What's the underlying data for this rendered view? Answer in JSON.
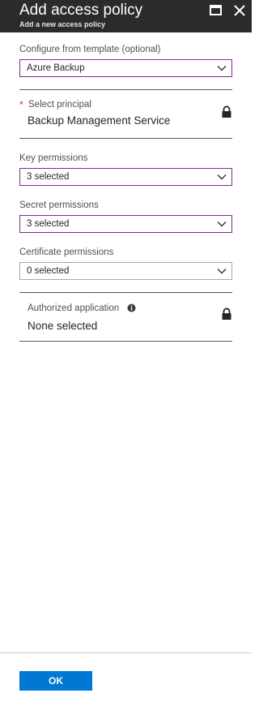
{
  "header": {
    "title": "Add access policy",
    "subtitle": "Add a new access policy"
  },
  "template": {
    "label": "Configure from template (optional)",
    "value": "Azure Backup"
  },
  "principal": {
    "required_mark": "*",
    "label": "Select principal",
    "value": "Backup Management Service"
  },
  "key_permissions": {
    "label": "Key permissions",
    "value": "3 selected"
  },
  "secret_permissions": {
    "label": "Secret permissions",
    "value": "3 selected"
  },
  "certificate_permissions": {
    "label": "Certificate permissions",
    "value": "0 selected"
  },
  "authorized_application": {
    "label": "Authorized application",
    "value": "None selected"
  },
  "footer": {
    "ok_label": "OK"
  },
  "icons": {
    "maximize": "maximize-icon",
    "close": "close-icon",
    "dropdown": "chevron-down-icon",
    "lock": "lock-icon",
    "info": "info-icon"
  },
  "colors": {
    "titlebar": "#2b2b2b",
    "active_border": "#7a2f8a",
    "required": "#d32f2f",
    "primary_button": "#0078d4"
  }
}
